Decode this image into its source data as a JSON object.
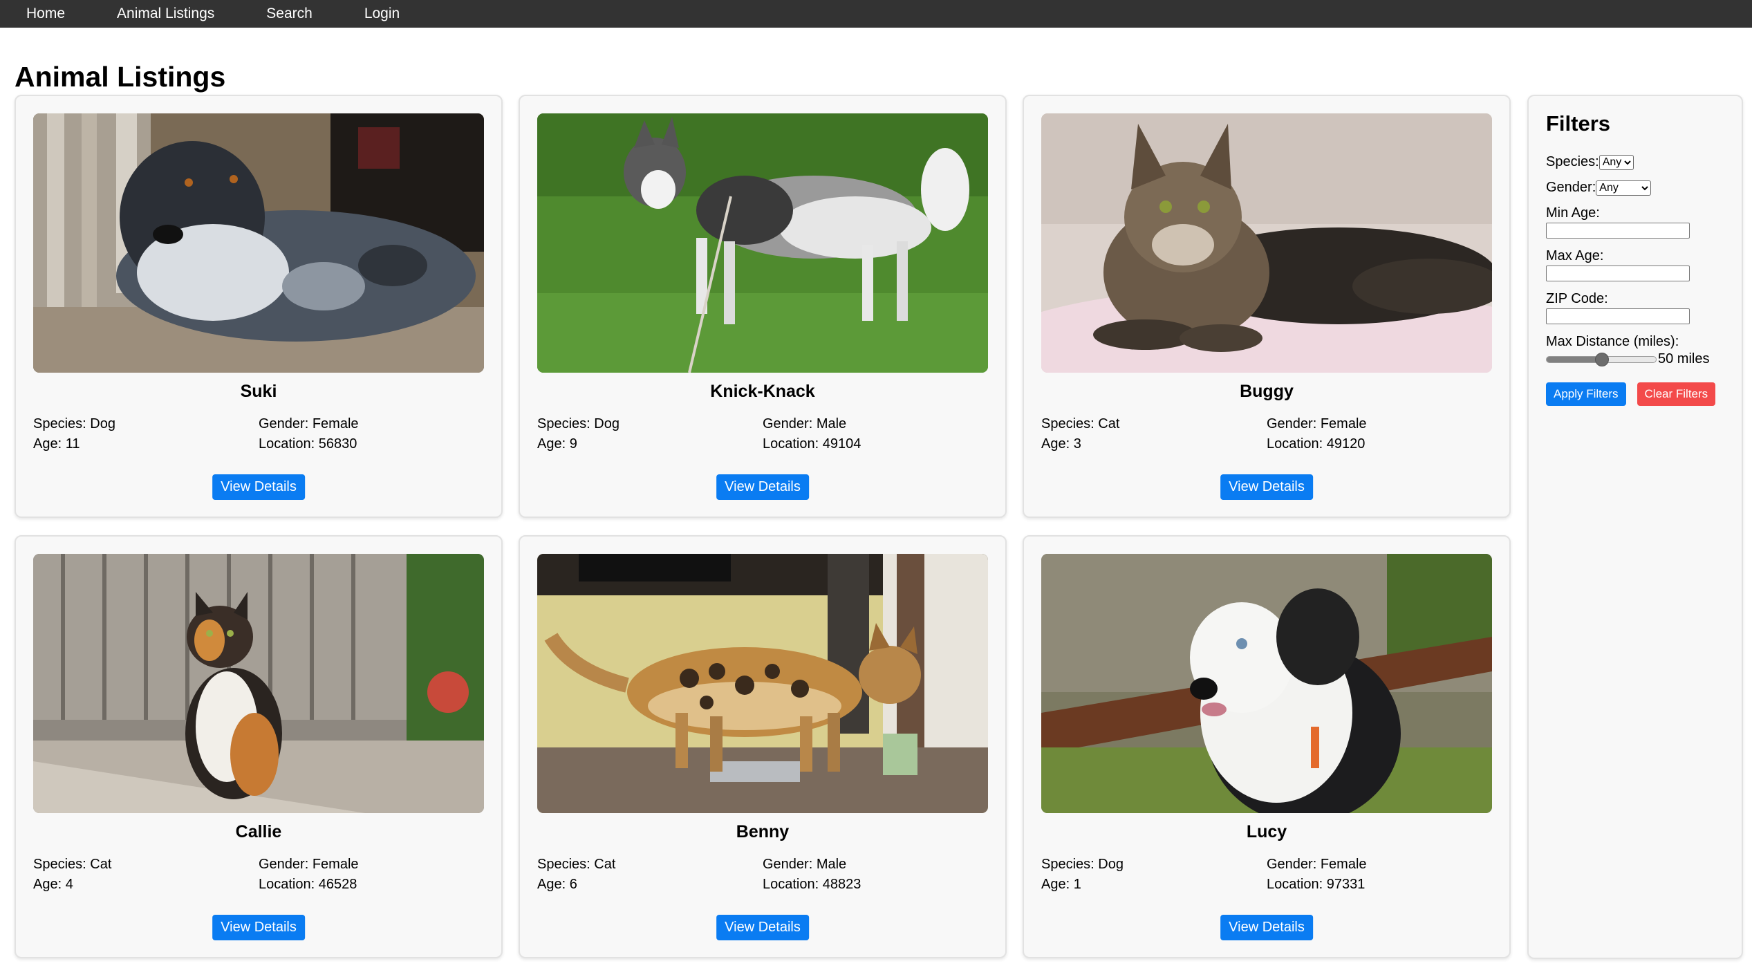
{
  "nav": [
    "Home",
    "Animal Listings",
    "Search",
    "Login"
  ],
  "page_title": "Animal Listings",
  "labels": {
    "species": "Species:",
    "gender": "Gender:",
    "age": "Age:",
    "location": "Location:",
    "view_details": "View Details"
  },
  "animals": [
    {
      "name": "Suki",
      "species": "Dog",
      "gender": "Female",
      "age": "11",
      "location": "56830",
      "photo": "dog-merle-photo"
    },
    {
      "name": "Knick-Knack",
      "species": "Dog",
      "gender": "Male",
      "age": "9",
      "location": "49104",
      "photo": "husky-on-grass-photo"
    },
    {
      "name": "Buggy",
      "species": "Cat",
      "gender": "Female",
      "age": "3",
      "location": "49120",
      "photo": "maine-coon-cat-photo"
    },
    {
      "name": "Callie",
      "species": "Cat",
      "gender": "Female",
      "age": "4",
      "location": "46528",
      "photo": "calico-cat-photo"
    },
    {
      "name": "Benny",
      "species": "Cat",
      "gender": "Male",
      "age": "6",
      "location": "48823",
      "photo": "bengal-cat-photo"
    },
    {
      "name": "Lucy",
      "species": "Dog",
      "gender": "Female",
      "age": "1",
      "location": "97331",
      "photo": "sheepdog-puppy-photo"
    }
  ],
  "filters": {
    "title": "Filters",
    "species_label": "Species:",
    "species_value": "Any",
    "gender_label": "Gender:",
    "gender_value": "Any",
    "min_age_label": "Min Age:",
    "min_age_value": "",
    "max_age_label": "Max Age:",
    "max_age_value": "",
    "zip_label": "ZIP Code:",
    "zip_value": "",
    "distance_label": "Max Distance (miles):",
    "distance_value": "50 miles",
    "distance_fraction": 0.5,
    "apply_label": "Apply Filters",
    "clear_label": "Clear Filters"
  },
  "colors": {
    "nav_bg": "#333333",
    "primary_button": "#0a7cf2",
    "danger_button": "#f34a4a",
    "card_bg": "#f8f8f8"
  }
}
